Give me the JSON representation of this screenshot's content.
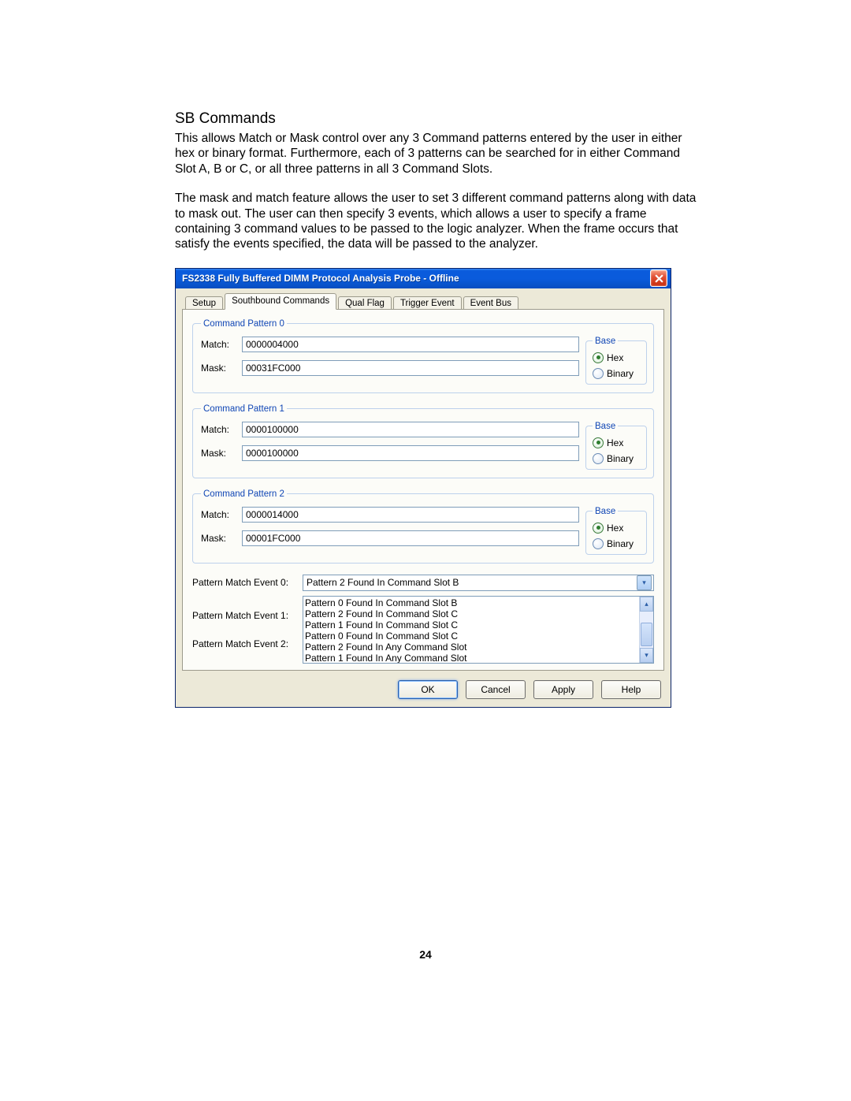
{
  "doc": {
    "heading": "SB Commands",
    "para1": "This allows Match or Mask control over any 3 Command patterns entered by the user in either hex or binary format. Furthermore, each of 3 patterns can be searched for in either Command Slot A, B or C, or all three patterns in all 3 Command Slots.",
    "para2": "The mask and match feature allows the user to set 3 different command patterns along with data to mask out.  The user can then specify 3 events, which allows a user to specify a frame containing 3 command values to be passed to the logic analyzer. When the frame occurs that satisfy the events specified, the data will be passed to the analyzer.",
    "page_number": "24"
  },
  "dialog": {
    "title": "FS2338 Fully Buffered DIMM Protocol Analysis Probe - Offline",
    "tabs": [
      "Setup",
      "Southbound Commands",
      "Qual Flag",
      "Trigger Event",
      "Event Bus"
    ],
    "active_tab_index": 1,
    "patterns": [
      {
        "legend": "Command Pattern 0",
        "match": "0000004000",
        "mask": "00031FC000",
        "base": "Hex"
      },
      {
        "legend": "Command Pattern 1",
        "match": "0000100000",
        "mask": "0000100000",
        "base": "Hex"
      },
      {
        "legend": "Command Pattern 2",
        "match": "0000014000",
        "mask": "00001FC000",
        "base": "Hex"
      }
    ],
    "labels": {
      "match": "Match:",
      "mask": "Mask:",
      "base_legend": "Base",
      "base_hex": "Hex",
      "base_binary": "Binary"
    },
    "events": {
      "label0": "Pattern Match Event 0:",
      "label1": "Pattern Match Event 1:",
      "label2": "Pattern Match Event 2:",
      "event0_value": "Pattern 2 Found In Command Slot B",
      "listbox_items": [
        "Pattern 0 Found In Command Slot B",
        "Pattern 2 Found In Command Slot C",
        "Pattern 1 Found In Command Slot C",
        "Pattern 0 Found In Command Slot C",
        "Pattern 2 Found In Any Command Slot",
        "Pattern 1 Found In Any Command Slot"
      ]
    },
    "buttons": {
      "ok": "OK",
      "cancel": "Cancel",
      "apply": "Apply",
      "help": "Help"
    }
  }
}
